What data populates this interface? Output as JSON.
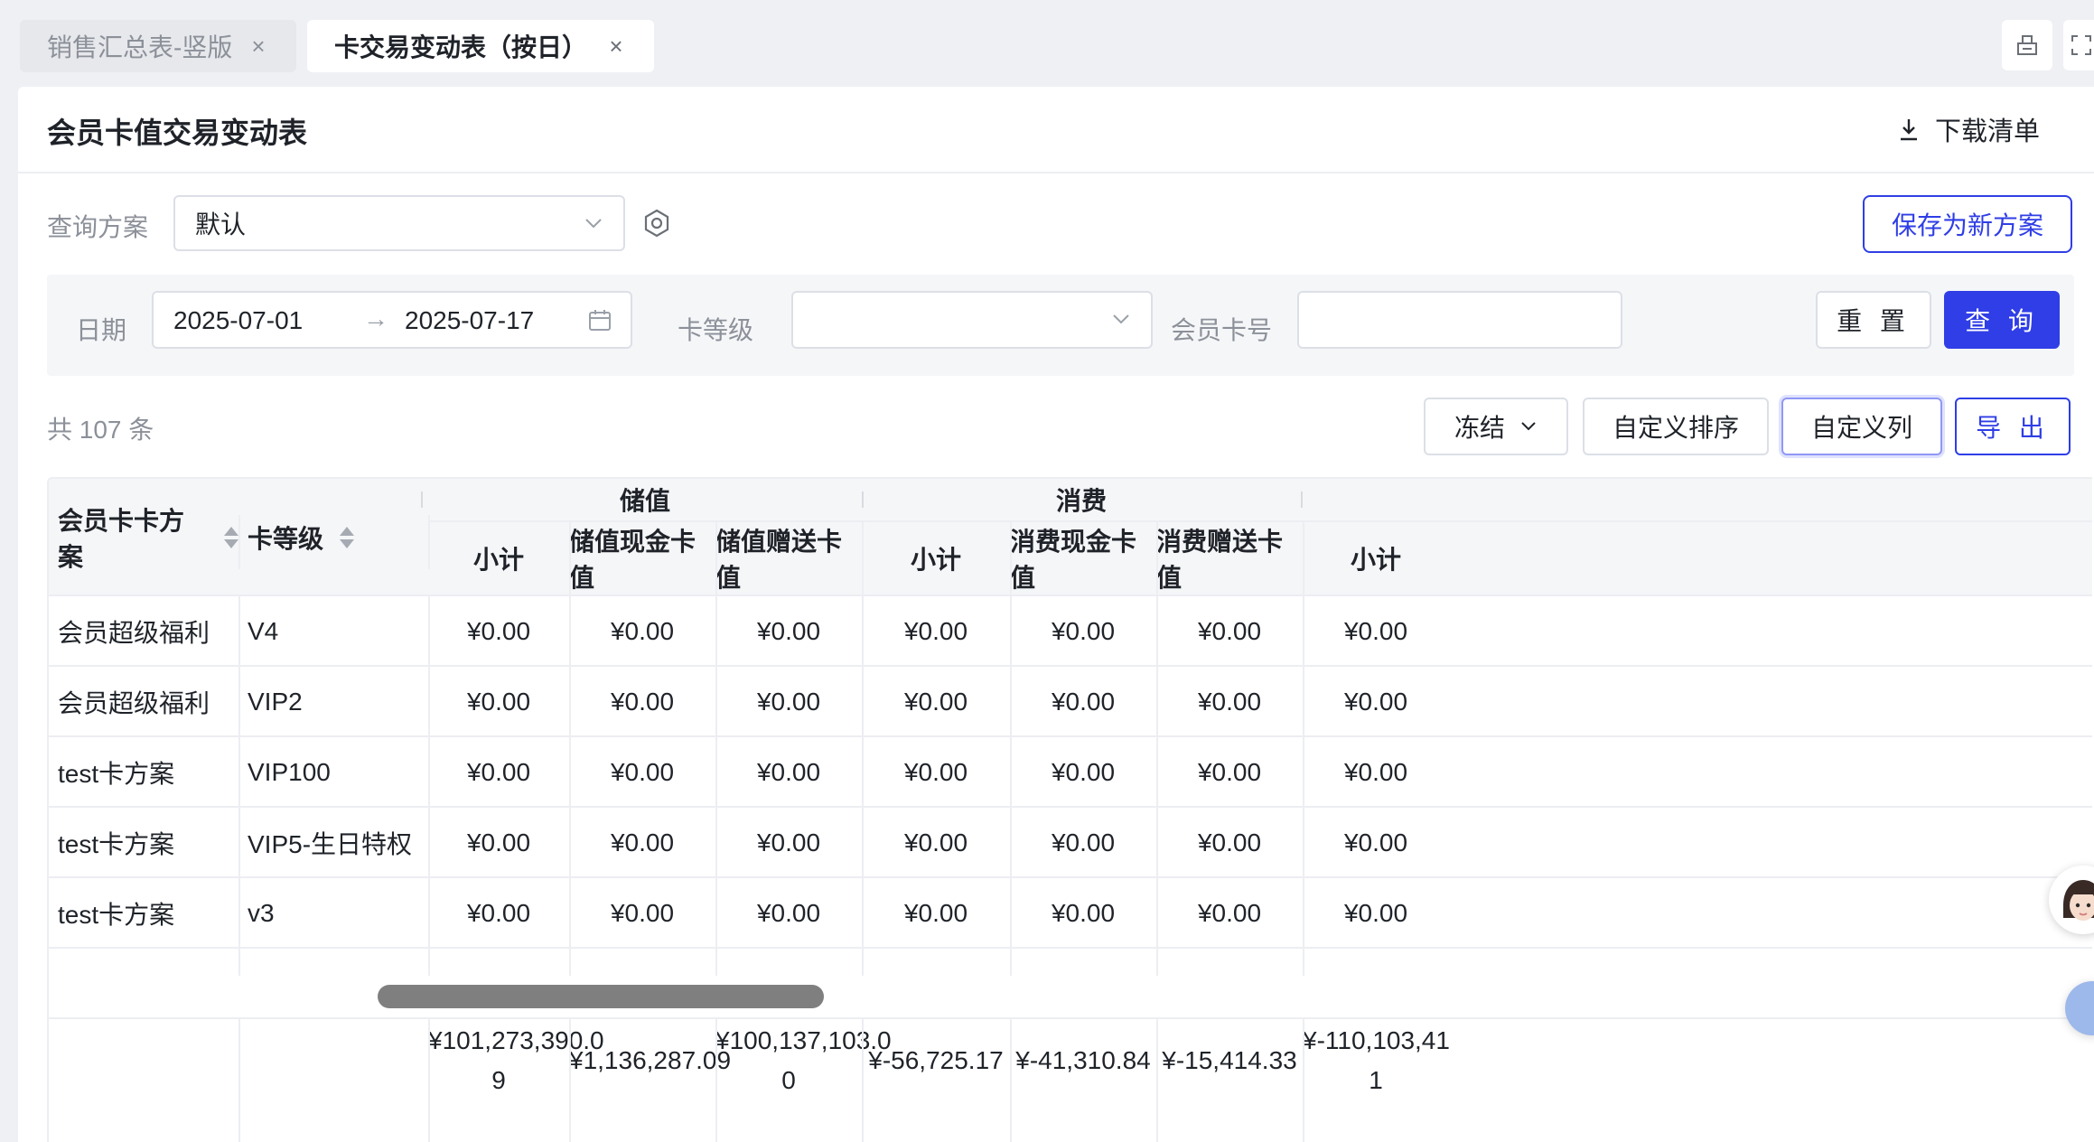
{
  "tabs": [
    {
      "label": "销售汇总表-竖版",
      "close": "×"
    },
    {
      "label": "卡交易变动表（按日）",
      "close": "×"
    }
  ],
  "header": {
    "title": "会员卡值交易变动表",
    "download_label": "下载清单"
  },
  "scheme": {
    "label": "查询方案",
    "value": "默认",
    "save_label": "保存为新方案"
  },
  "filters": {
    "date_label": "日期",
    "date_start": "2025-07-01",
    "date_arrow": "→",
    "date_end": "2025-07-17",
    "level_label": "卡等级",
    "level_value": "",
    "cardno_label": "会员卡号",
    "cardno_value": "",
    "reset_label": "重 置",
    "query_label": "查 询"
  },
  "toolbar": {
    "total_text": "共 107 条",
    "freeze_label": "冻结",
    "sort_label": "自定义排序",
    "columns_label": "自定义列",
    "export_label": "导 出"
  },
  "table": {
    "col_scheme": "会员卡卡方案",
    "col_level": "卡等级",
    "group_recharge": "储值",
    "group_consume": "消费",
    "sub_headers": [
      "小计",
      "储值现金卡值",
      "储值赠送卡值",
      "小计",
      "消费现金卡值",
      "消费赠送卡值",
      "小计"
    ],
    "rows": [
      {
        "scheme": "会员超级福利",
        "level": "V4",
        "values": [
          "¥0.00",
          "¥0.00",
          "¥0.00",
          "¥0.00",
          "¥0.00",
          "¥0.00",
          "¥0.00"
        ]
      },
      {
        "scheme": "会员超级福利",
        "level": "VIP2",
        "values": [
          "¥0.00",
          "¥0.00",
          "¥0.00",
          "¥0.00",
          "¥0.00",
          "¥0.00",
          "¥0.00"
        ]
      },
      {
        "scheme": "test卡方案",
        "level": "VIP100",
        "values": [
          "¥0.00",
          "¥0.00",
          "¥0.00",
          "¥0.00",
          "¥0.00",
          "¥0.00",
          "¥0.00"
        ]
      },
      {
        "scheme": "test卡方案",
        "level": "VIP5-生日特权",
        "values": [
          "¥0.00",
          "¥0.00",
          "¥0.00",
          "¥0.00",
          "¥0.00",
          "¥0.00",
          "¥0.00"
        ]
      },
      {
        "scheme": "test卡方案",
        "level": "v3",
        "values": [
          "¥0.00",
          "¥0.00",
          "¥0.00",
          "¥0.00",
          "¥0.00",
          "¥0.00",
          "¥0.00"
        ]
      }
    ],
    "totals": [
      {
        "line1": "¥101,273,390.0",
        "line2": "9"
      },
      {
        "line1": "¥1,136,287.09",
        "line2": ""
      },
      {
        "line1": "¥100,137,103.0",
        "line2": "0"
      },
      {
        "line1": "¥-56,725.17",
        "line2": ""
      },
      {
        "line1": "¥-41,310.84",
        "line2": ""
      },
      {
        "line1": "¥-15,414.33",
        "line2": ""
      },
      {
        "line1": "¥-110,103,41",
        "line2": "1"
      }
    ]
  }
}
